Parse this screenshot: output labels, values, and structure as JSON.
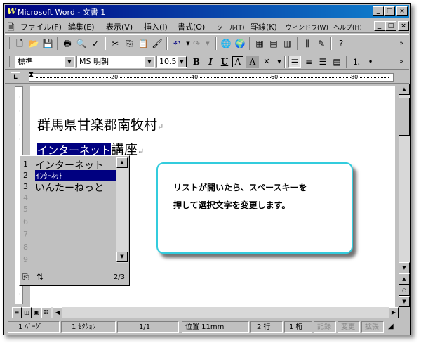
{
  "window": {
    "title": "Microsoft Word - 文書 1",
    "app_icon": "W"
  },
  "title_controls": [
    "_",
    "□",
    "×"
  ],
  "menu": [
    "ファイル(F)",
    "編集(E)",
    "表示(V)",
    "挿入(I)",
    "書式(O)",
    "ツール(T)",
    "罫線(K)",
    "ウィンドウ(W)",
    "ヘルプ(H)"
  ],
  "toolbar": {
    "style": "標準",
    "font": "MS 明朝",
    "size": "10.5",
    "bold": "B",
    "italic": "I",
    "underline": "U",
    "border_char": "A",
    "shade_char": "A",
    "phonetic": "文"
  },
  "ruler": {
    "marks": [
      "20",
      "40",
      "60",
      "80"
    ]
  },
  "document": {
    "line1": "群馬県甘楽郡南牧村",
    "line2_selected": "インターネット",
    "line2_rest": "講座",
    "para_mark": "↵"
  },
  "ime": {
    "candidates": [
      {
        "num": "1",
        "text": "インターネット"
      },
      {
        "num": "2",
        "text": "ｲﾝﾀｰﾈｯﾄ"
      },
      {
        "num": "3",
        "text": "いんたーねっと"
      },
      {
        "num": "4",
        "text": ""
      },
      {
        "num": "5",
        "text": ""
      },
      {
        "num": "6",
        "text": ""
      },
      {
        "num": "7",
        "text": ""
      },
      {
        "num": "8",
        "text": ""
      },
      {
        "num": "9",
        "text": ""
      }
    ],
    "selected_index": 1,
    "count": "2/3"
  },
  "callout": {
    "text": "リストが開いたら、スペースキーを\n押して選択文字を変更します。"
  },
  "status": {
    "page": "1 ﾍﾟｰｼﾞ",
    "section": "1 ｾｸｼｮﾝ",
    "pages": "1/1",
    "position": "位置 11mm",
    "line": "2 行",
    "column": "1 桁",
    "rec": "記録",
    "trk": "変更",
    "ext": "拡張"
  },
  "colors": {
    "title_bar": "#000080",
    "callout_border": "#33ccdd",
    "selection": "#000080"
  }
}
